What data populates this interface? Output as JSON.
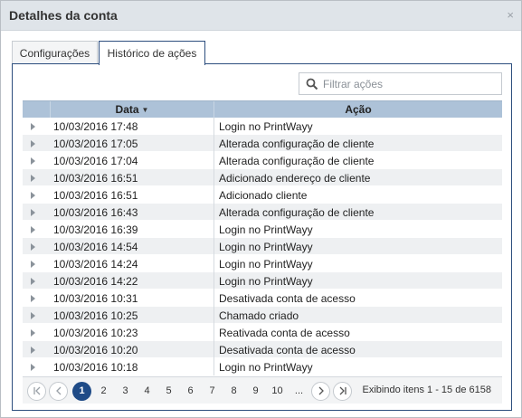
{
  "window": {
    "title": "Detalhes da conta",
    "close_glyph": "×"
  },
  "tabs": [
    {
      "label": "Configurações",
      "active": false
    },
    {
      "label": "Histórico de ações",
      "active": true
    }
  ],
  "search": {
    "placeholder": "Filtrar ações",
    "value": "",
    "icon": "search-icon"
  },
  "grid": {
    "columns": {
      "data": "Data",
      "acao": "Ação"
    },
    "sort_indicator": "▼",
    "rows": [
      {
        "date": "10/03/2016 17:48",
        "action": "Login no PrintWayy"
      },
      {
        "date": "10/03/2016 17:05",
        "action": "Alterada configuração de cliente"
      },
      {
        "date": "10/03/2016 17:04",
        "action": "Alterada configuração de cliente"
      },
      {
        "date": "10/03/2016 16:51",
        "action": "Adicionado endereço de cliente"
      },
      {
        "date": "10/03/2016 16:51",
        "action": "Adicionado cliente"
      },
      {
        "date": "10/03/2016 16:43",
        "action": "Alterada configuração de cliente"
      },
      {
        "date": "10/03/2016 16:39",
        "action": "Login no PrintWayy"
      },
      {
        "date": "10/03/2016 14:54",
        "action": "Login no PrintWayy"
      },
      {
        "date": "10/03/2016 14:24",
        "action": "Login no PrintWayy"
      },
      {
        "date": "10/03/2016 14:22",
        "action": "Login no PrintWayy"
      },
      {
        "date": "10/03/2016 10:31",
        "action": "Desativada conta de acesso"
      },
      {
        "date": "10/03/2016 10:25",
        "action": "Chamado criado"
      },
      {
        "date": "10/03/2016 10:23",
        "action": "Reativada conta de acesso"
      },
      {
        "date": "10/03/2016 10:20",
        "action": "Desativada conta de acesso"
      },
      {
        "date": "10/03/2016 10:18",
        "action": "Login no PrintWayy"
      }
    ]
  },
  "pager": {
    "first": "⏮",
    "prev": "‹",
    "next": "›",
    "last": "⏭",
    "pages": [
      "1",
      "2",
      "3",
      "4",
      "5",
      "6",
      "7",
      "8",
      "9",
      "10",
      "..."
    ],
    "active_page": "1",
    "info": "Exibindo itens 1 - 15 de 6158"
  }
}
